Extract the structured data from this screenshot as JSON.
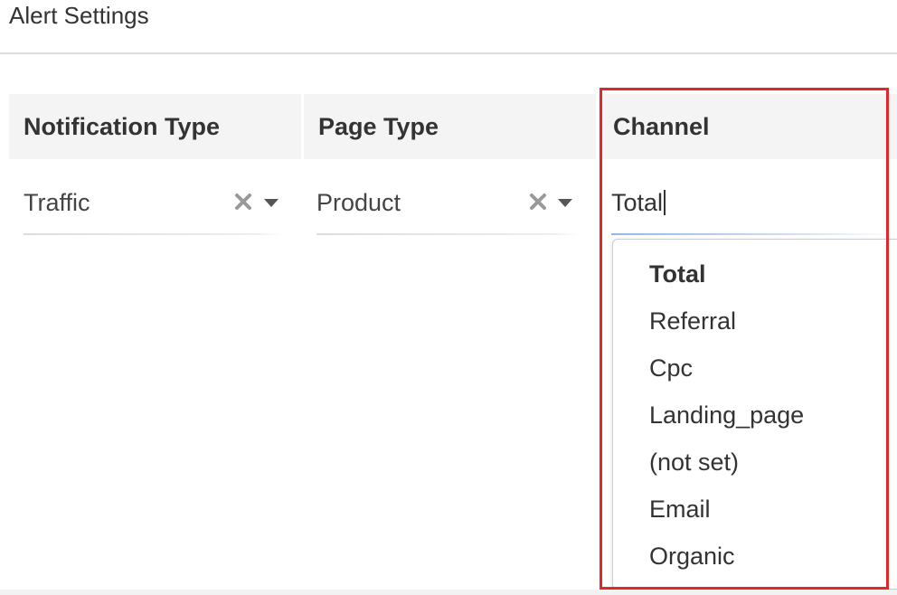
{
  "page": {
    "title": "Alert Settings"
  },
  "columns": [
    {
      "header": "Notification Type",
      "value": "Traffic"
    },
    {
      "header": "Page Type",
      "value": "Product"
    },
    {
      "header": "Channel",
      "value": "Total"
    }
  ],
  "icons": {
    "clear": "clear-x-icon",
    "caret": "chevron-down-icon"
  },
  "channel_dropdown": {
    "options": [
      "Total",
      "Referral",
      "Cpc",
      "Landing_page",
      "(not set)",
      "Email",
      "Organic"
    ],
    "selected": "Total"
  },
  "colors": {
    "highlight": "#e0282a",
    "focus_underline": "#8fb9e6",
    "header_bg": "#f4f4f4"
  }
}
